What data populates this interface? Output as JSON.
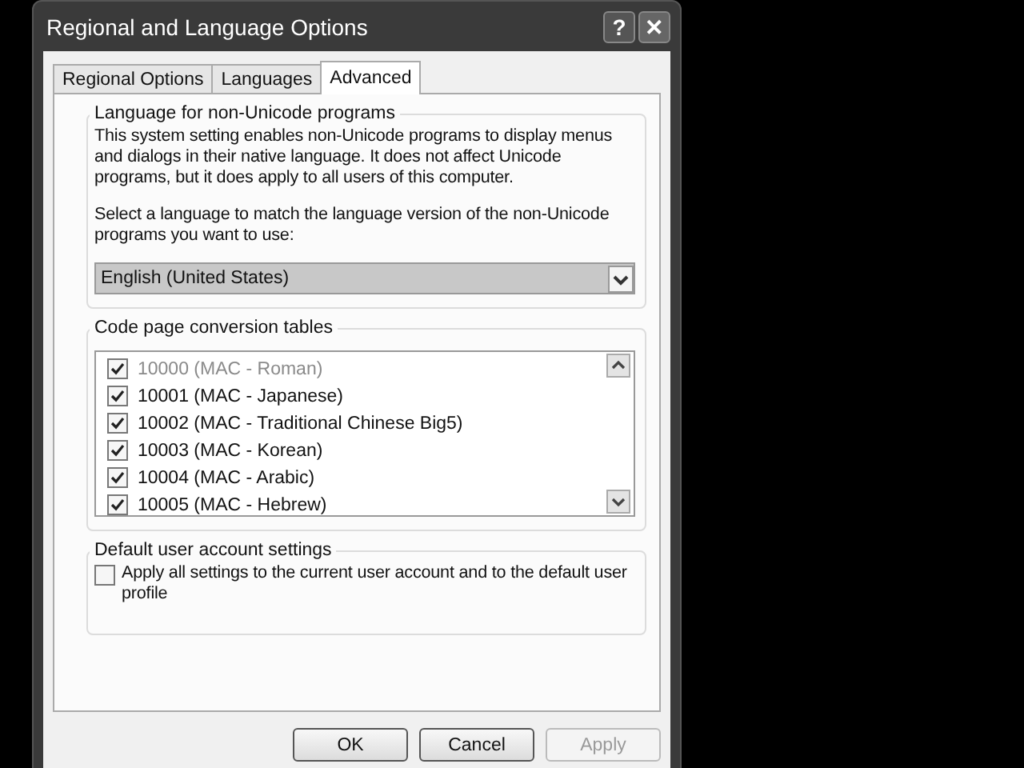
{
  "window": {
    "title": "Regional and Language Options",
    "controls": [
      "?",
      "✕"
    ]
  },
  "tabs": [
    {
      "label": "Regional Options",
      "selected": false
    },
    {
      "label": "Languages",
      "selected": false
    },
    {
      "label": "Advanced",
      "selected": true
    }
  ],
  "non_unicode_group": {
    "title": "Language for non-Unicode programs",
    "description": "This system setting enables non-Unicode programs to display menus and dialogs in their native language. It does not affect Unicode programs, but it does apply to all users of this computer.",
    "prompt": "Select a language to match the language version of the non-Unicode programs you want to use:",
    "language": "English (United States)"
  },
  "code_page_group": {
    "title": "Code page conversion tables",
    "items": [
      {
        "label": "10000 (MAC - Roman)",
        "checked": true,
        "disabled": true
      },
      {
        "label": "10001 (MAC - Japanese)",
        "checked": true,
        "disabled": false
      },
      {
        "label": "10002 (MAC - Traditional Chinese Big5)",
        "checked": true,
        "disabled": false
      },
      {
        "label": "10003 (MAC - Korean)",
        "checked": true,
        "disabled": false
      },
      {
        "label": "10004 (MAC - Arabic)",
        "checked": true,
        "disabled": false
      },
      {
        "label": "10005 (MAC - Hebrew)",
        "checked": true,
        "disabled": false
      }
    ]
  },
  "default_user_group": {
    "title": "Default user account settings",
    "option": {
      "label": "Apply all settings to the current user account and to the default user profile",
      "checked": false
    }
  },
  "buttons": [
    {
      "label": "OK",
      "disabled": false
    },
    {
      "label": "Cancel",
      "disabled": false
    },
    {
      "label": "Apply",
      "disabled": true
    }
  ]
}
